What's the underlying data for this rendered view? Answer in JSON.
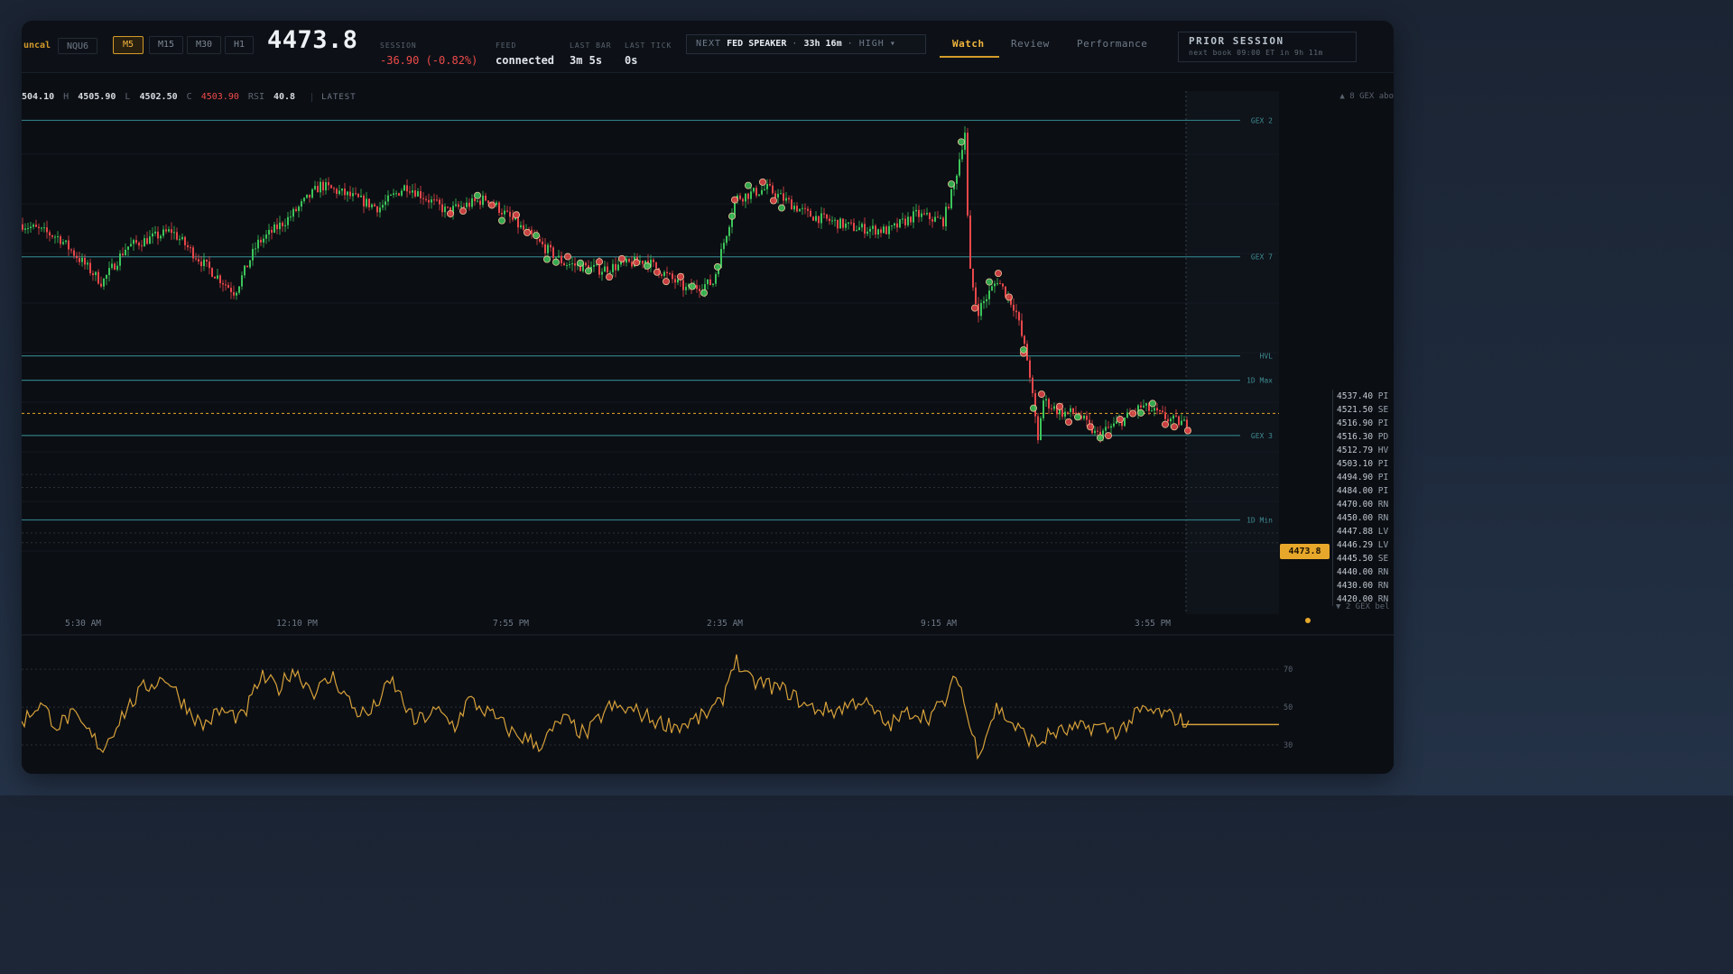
{
  "header": {
    "ticker_fragment": "uncal",
    "symbol": "NQU6",
    "timeframes": [
      {
        "label": "M5",
        "active": true
      },
      {
        "label": "M15",
        "active": false
      },
      {
        "label": "M30",
        "active": false
      },
      {
        "label": "H1",
        "active": false
      }
    ],
    "last_price": "4473.8",
    "session": {
      "label": "SESSION",
      "value": "-36.90 (-0.82%)"
    },
    "feed": {
      "label": "FEED",
      "value": "connected"
    },
    "last_bar": {
      "label": "LAST BAR",
      "value": "3m 5s"
    },
    "last_tick": {
      "label": "LAST TICK",
      "value": "0s"
    },
    "next_event": {
      "prefix": "NEXT",
      "name": "FED SPEAKER",
      "countdown": "33h 16m",
      "impact": "HIGH",
      "sep": "·",
      "caret": "▾"
    },
    "tabs": [
      {
        "label": "Watch",
        "active": true
      },
      {
        "label": "Review",
        "active": false
      },
      {
        "label": "Performance",
        "active": false
      }
    ],
    "prior_session": {
      "title": "PRIOR SESSION",
      "subtitle": "next book 09:00 ET in 9h 11m"
    }
  },
  "ohlc": {
    "open_value": "504.10",
    "high_key": "H",
    "high_value": "4505.90",
    "low_key": "L",
    "low_value": "4502.50",
    "close_key": "C",
    "close_value": "4503.90",
    "rsi_key": "RSI",
    "rsi_value": "40.8",
    "latest_label": "LATEST"
  },
  "gex_above_label": "▲ 8 GEX abo",
  "gex_below_label": "▼ 2 GEX bel",
  "price_tag": "4473.8",
  "colors": {
    "up": "#3cc45a",
    "down": "#e8474a",
    "accent": "#e7a72a",
    "level": "#2e7a80",
    "rsi": "#d7a13a"
  },
  "chart_data": {
    "type": "candlestick",
    "x_tick_labels": [
      "5:30 AM",
      "12:10 PM",
      "7:55 PM",
      "2:35 AM",
      "9:15 AM",
      "3:55 PM"
    ],
    "ylim": [
      4412,
      4573
    ],
    "last_price": 4473.8,
    "path_anchors": [
      [
        0,
        4532
      ],
      [
        40,
        4528
      ],
      [
        88,
        4514
      ],
      [
        115,
        4525
      ],
      [
        165,
        4530
      ],
      [
        200,
        4520
      ],
      [
        235,
        4511
      ],
      [
        260,
        4526
      ],
      [
        295,
        4534
      ],
      [
        330,
        4544
      ],
      [
        360,
        4541
      ],
      [
        395,
        4537
      ],
      [
        425,
        4544
      ],
      [
        470,
        4536
      ],
      [
        515,
        4540
      ],
      [
        560,
        4529
      ],
      [
        600,
        4520
      ],
      [
        640,
        4518
      ],
      [
        690,
        4521
      ],
      [
        735,
        4512
      ],
      [
        765,
        4514
      ],
      [
        790,
        4540
      ],
      [
        825,
        4543
      ],
      [
        870,
        4535
      ],
      [
        920,
        4531
      ],
      [
        960,
        4530
      ],
      [
        990,
        4535
      ],
      [
        1020,
        4533
      ],
      [
        1032,
        4544
      ],
      [
        1045,
        4562
      ],
      [
        1048,
        4520
      ],
      [
        1058,
        4505
      ],
      [
        1080,
        4515
      ],
      [
        1100,
        4506
      ],
      [
        1115,
        4488
      ],
      [
        1125,
        4465
      ],
      [
        1130,
        4478
      ],
      [
        1150,
        4474
      ],
      [
        1168,
        4474
      ],
      [
        1190,
        4467
      ],
      [
        1215,
        4471
      ],
      [
        1240,
        4476
      ],
      [
        1270,
        4472
      ],
      [
        1295,
        4470
      ]
    ],
    "levels": [
      {
        "name": "GEX 2",
        "price": 4564.0
      },
      {
        "name": "GEX 7",
        "price": 4522.0
      },
      {
        "name": "HVL",
        "price": 4491.5
      },
      {
        "name": "1D Max",
        "price": 4484.0
      },
      {
        "name": "GEX 3",
        "price": 4467.0
      },
      {
        "name": "1D Min",
        "price": 4441.0
      }
    ],
    "level_list": [
      {
        "price": "4537.40",
        "tag": "PI"
      },
      {
        "price": "4521.50",
        "tag": "SE"
      },
      {
        "price": "4516.90",
        "tag": "PI"
      },
      {
        "price": "4516.30",
        "tag": "PD"
      },
      {
        "price": "4512.79",
        "tag": "HV"
      },
      {
        "price": "4503.10",
        "tag": "PI"
      },
      {
        "price": "4494.90",
        "tag": "PI"
      },
      {
        "price": "4484.00",
        "tag": "PI"
      },
      {
        "price": "4470.00",
        "tag": "RN"
      },
      {
        "price": "4450.00",
        "tag": "RN"
      },
      {
        "price": "4447.88",
        "tag": "LV"
      },
      {
        "price": "4446.29",
        "tag": "LV"
      },
      {
        "price": "4445.50",
        "tag": "SE"
      },
      {
        "price": "4440.00",
        "tag": "RN"
      },
      {
        "price": "4430.00",
        "tag": "RN"
      },
      {
        "price": "4420.00",
        "tag": "RN"
      }
    ],
    "rsi": {
      "y_ticks": [
        70,
        50,
        30
      ],
      "ylim": [
        20,
        82
      ],
      "last_value": 40.8,
      "anchors": [
        [
          0,
          42
        ],
        [
          20,
          52
        ],
        [
          40,
          40
        ],
        [
          55,
          46
        ],
        [
          75,
          36
        ],
        [
          90,
          28
        ],
        [
          110,
          45
        ],
        [
          135,
          60
        ],
        [
          160,
          66
        ],
        [
          175,
          55
        ],
        [
          200,
          40
        ],
        [
          220,
          48
        ],
        [
          245,
          44
        ],
        [
          265,
          66
        ],
        [
          285,
          60
        ],
        [
          300,
          70
        ],
        [
          325,
          58
        ],
        [
          345,
          66
        ],
        [
          370,
          48
        ],
        [
          385,
          46
        ],
        [
          410,
          64
        ],
        [
          435,
          42
        ],
        [
          460,
          48
        ],
        [
          480,
          40
        ],
        [
          495,
          54
        ],
        [
          520,
          46
        ],
        [
          545,
          36
        ],
        [
          575,
          30
        ],
        [
          600,
          44
        ],
        [
          625,
          35
        ],
        [
          650,
          50
        ],
        [
          680,
          48
        ],
        [
          705,
          42
        ],
        [
          730,
          40
        ],
        [
          755,
          45
        ],
        [
          775,
          52
        ],
        [
          790,
          76
        ],
        [
          805,
          64
        ],
        [
          825,
          62
        ],
        [
          850,
          58
        ],
        [
          870,
          50
        ],
        [
          900,
          48
        ],
        [
          930,
          54
        ],
        [
          960,
          40
        ],
        [
          985,
          48
        ],
        [
          1005,
          45
        ],
        [
          1025,
          54
        ],
        [
          1037,
          68
        ],
        [
          1050,
          40
        ],
        [
          1060,
          26
        ],
        [
          1080,
          50
        ],
        [
          1100,
          40
        ],
        [
          1125,
          30
        ],
        [
          1140,
          36
        ],
        [
          1165,
          38
        ],
        [
          1190,
          40
        ],
        [
          1215,
          37
        ],
        [
          1240,
          48
        ],
        [
          1260,
          47
        ],
        [
          1280,
          44
        ],
        [
          1295,
          41
        ]
      ]
    }
  }
}
